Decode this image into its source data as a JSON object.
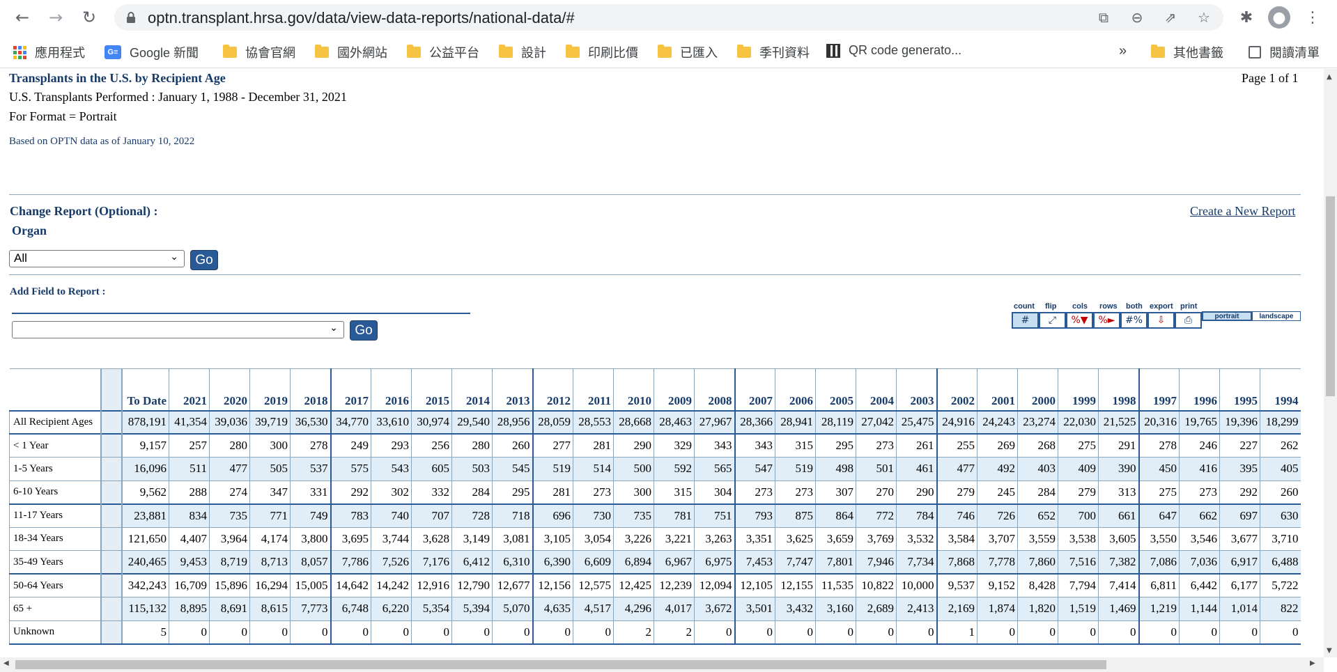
{
  "browser": {
    "url": "optn.transplant.hrsa.gov/data/view-data-reports/national-data/#",
    "bookmarks": [
      {
        "label": "應用程式",
        "icon": "apps-grid-icon"
      },
      {
        "label": "Google 新聞",
        "icon": "google-news-icon"
      },
      {
        "label": "協會官網",
        "icon": "folder-icon"
      },
      {
        "label": "國外網站",
        "icon": "folder-icon"
      },
      {
        "label": "公益平台",
        "icon": "folder-icon"
      },
      {
        "label": "設計",
        "icon": "folder-icon"
      },
      {
        "label": "印刷比價",
        "icon": "folder-icon"
      },
      {
        "label": "已匯入",
        "icon": "folder-icon"
      },
      {
        "label": "季刊資料",
        "icon": "folder-icon"
      },
      {
        "label": "QR code generato...",
        "icon": "qr-icon"
      }
    ],
    "overflow": "»",
    "other_bookmarks": "其他書籤",
    "reading_list": "閱讀清單",
    "colors": {
      "accent": "#1a73e8"
    }
  },
  "report": {
    "title": "Transplants in the U.S. by Recipient Age",
    "page_indicator": "Page 1 of 1",
    "performed": "U.S. Transplants Performed : January 1, 1988 - December 31, 2021",
    "format": "For Format = Portrait",
    "based_on": "Based on OPTN data as of January 10, 2022",
    "change_label": "Change Report (Optional) :",
    "organ_label": "Organ",
    "create_link": "Create a New Report",
    "organ_value": "All",
    "go_label": "Go",
    "add_field_label": "Add Field to Report :",
    "field_value": "",
    "tools": [
      {
        "label": "count",
        "glyph": "#"
      },
      {
        "label": "flip",
        "glyph": "⤢"
      },
      {
        "label": "cols",
        "glyph": "%▼"
      },
      {
        "label": "rows",
        "glyph": "%►"
      },
      {
        "label": "both",
        "glyph": "#%"
      },
      {
        "label": "export",
        "glyph": "⇩"
      },
      {
        "label": "print",
        "glyph": "⎙"
      }
    ],
    "layouts": [
      "portrait",
      "landscape"
    ],
    "colors": {
      "title": "#163b6a",
      "button": "#2a5a96",
      "shade": "#e1eef8"
    }
  },
  "table": {
    "headers": [
      "To Date",
      "2021",
      "2020",
      "2019",
      "2018",
      "2017",
      "2016",
      "2015",
      "2014",
      "2013",
      "2012",
      "2011",
      "2010",
      "2009",
      "2008",
      "2007",
      "2006",
      "2005",
      "2004",
      "2003",
      "2002",
      "2001",
      "2000",
      "1999",
      "1998",
      "1997",
      "1996",
      "1995",
      "1994"
    ],
    "rows": [
      {
        "label": "All Recipient Ages",
        "values": [
          "878,191",
          "41,354",
          "39,036",
          "39,719",
          "36,530",
          "34,770",
          "33,610",
          "30,974",
          "29,540",
          "28,956",
          "28,059",
          "28,553",
          "28,668",
          "28,463",
          "27,967",
          "28,366",
          "28,941",
          "28,119",
          "27,042",
          "25,475",
          "24,916",
          "24,243",
          "23,274",
          "22,030",
          "21,525",
          "20,316",
          "19,765",
          "19,396",
          "18,299"
        ]
      },
      {
        "label": "< 1 Year",
        "values": [
          "9,157",
          "257",
          "280",
          "300",
          "278",
          "249",
          "293",
          "256",
          "280",
          "260",
          "277",
          "281",
          "290",
          "329",
          "343",
          "343",
          "315",
          "295",
          "273",
          "261",
          "255",
          "269",
          "268",
          "275",
          "291",
          "278",
          "246",
          "227",
          "262"
        ]
      },
      {
        "label": "1-5 Years",
        "values": [
          "16,096",
          "511",
          "477",
          "505",
          "537",
          "575",
          "543",
          "605",
          "503",
          "545",
          "519",
          "514",
          "500",
          "592",
          "565",
          "547",
          "519",
          "498",
          "501",
          "461",
          "477",
          "492",
          "403",
          "409",
          "390",
          "450",
          "416",
          "395",
          "405"
        ]
      },
      {
        "label": "6-10 Years",
        "values": [
          "9,562",
          "288",
          "274",
          "347",
          "331",
          "292",
          "302",
          "332",
          "284",
          "295",
          "281",
          "273",
          "300",
          "315",
          "304",
          "273",
          "273",
          "307",
          "270",
          "290",
          "279",
          "245",
          "284",
          "279",
          "313",
          "275",
          "273",
          "292",
          "260"
        ]
      },
      {
        "label": "11-17 Years",
        "values": [
          "23,881",
          "834",
          "735",
          "771",
          "749",
          "783",
          "740",
          "707",
          "728",
          "718",
          "696",
          "730",
          "735",
          "781",
          "751",
          "793",
          "875",
          "864",
          "772",
          "784",
          "746",
          "726",
          "652",
          "700",
          "661",
          "647",
          "662",
          "697",
          "630"
        ]
      },
      {
        "label": "18-34 Years",
        "values": [
          "121,650",
          "4,407",
          "3,964",
          "4,174",
          "3,800",
          "3,695",
          "3,744",
          "3,628",
          "3,149",
          "3,081",
          "3,105",
          "3,054",
          "3,226",
          "3,221",
          "3,263",
          "3,351",
          "3,625",
          "3,659",
          "3,769",
          "3,532",
          "3,584",
          "3,707",
          "3,559",
          "3,538",
          "3,605",
          "3,550",
          "3,546",
          "3,677",
          "3,710"
        ]
      },
      {
        "label": "35-49 Years",
        "values": [
          "240,465",
          "9,453",
          "8,719",
          "8,713",
          "8,057",
          "7,786",
          "7,526",
          "7,176",
          "6,412",
          "6,310",
          "6,390",
          "6,609",
          "6,894",
          "6,967",
          "6,975",
          "7,453",
          "7,747",
          "7,801",
          "7,946",
          "7,734",
          "7,868",
          "7,778",
          "7,860",
          "7,516",
          "7,382",
          "7,086",
          "7,036",
          "6,917",
          "6,488"
        ]
      },
      {
        "label": "50-64 Years",
        "values": [
          "342,243",
          "16,709",
          "15,896",
          "16,294",
          "15,005",
          "14,642",
          "14,242",
          "12,916",
          "12,790",
          "12,677",
          "12,156",
          "12,575",
          "12,425",
          "12,239",
          "12,094",
          "12,105",
          "12,155",
          "11,535",
          "10,822",
          "10,000",
          "9,537",
          "9,152",
          "8,428",
          "7,794",
          "7,414",
          "6,811",
          "6,442",
          "6,177",
          "5,722"
        ]
      },
      {
        "label": "65 +",
        "values": [
          "115,132",
          "8,895",
          "8,691",
          "8,615",
          "7,773",
          "6,748",
          "6,220",
          "5,354",
          "5,394",
          "5,070",
          "4,635",
          "4,517",
          "4,296",
          "4,017",
          "3,672",
          "3,501",
          "3,432",
          "3,160",
          "2,689",
          "2,413",
          "2,169",
          "1,874",
          "1,820",
          "1,519",
          "1,469",
          "1,219",
          "1,144",
          "1,014",
          "822"
        ]
      },
      {
        "label": "Unknown",
        "values": [
          "5",
          "0",
          "0",
          "0",
          "0",
          "0",
          "0",
          "0",
          "0",
          "0",
          "0",
          "0",
          "2",
          "2",
          "0",
          "0",
          "0",
          "0",
          "0",
          "0",
          "1",
          "0",
          "0",
          "0",
          "0",
          "0",
          "0",
          "0",
          "0"
        ]
      }
    ]
  }
}
